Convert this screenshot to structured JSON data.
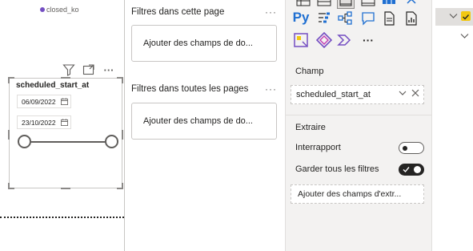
{
  "canvas": {
    "legend_label": "closed_ko",
    "legend_color": "#744ec2",
    "visual_header_icons": [
      "filter-icon",
      "focus-mode-icon",
      "more-options-icon"
    ],
    "more_glyph": "···",
    "slicer": {
      "title": "scheduled_start_at",
      "start_date": "06/09/2022",
      "end_date": "23/10/2022"
    }
  },
  "filters_pane": {
    "this_page_title": "Filtres dans cette page",
    "this_page_placeholder": "Ajouter des champs de do...",
    "all_pages_title": "Filtres dans toutes les pages",
    "all_pages_placeholder": "Ajouter des champs de do...",
    "more_glyph": "···"
  },
  "viz_pane": {
    "python_label": "Py",
    "more_glyph": "···",
    "field_section_label": "Champ",
    "field_value": "scheduled_start_at",
    "drillthrough_label": "Extraire",
    "cross_report_label": "Interrapport",
    "cross_report_on": false,
    "keep_filters_label": "Garder tous les filtres",
    "keep_filters_on": true,
    "drill_placeholder": "Ajouter des champs d'extr..."
  },
  "colors": {
    "accent": "#744ec2",
    "yellow_check": "#f2c811",
    "pane_bg": "#f3f2f1"
  }
}
